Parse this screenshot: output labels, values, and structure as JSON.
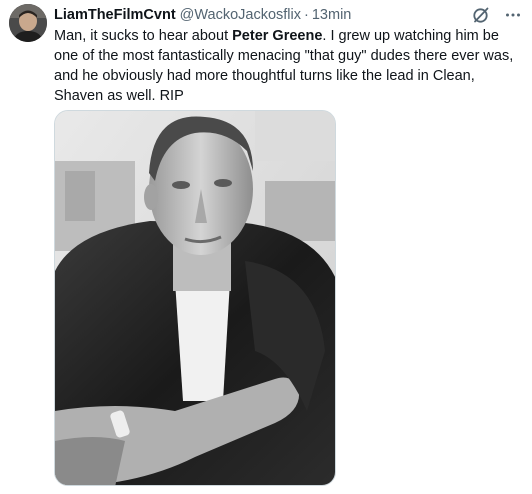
{
  "tweet": {
    "display_name": "LiamTheFilmCvnt",
    "handle": "@WackoJackosflix",
    "separator": "·",
    "time": "13min",
    "text_before": "Man, it sucks to hear about ",
    "text_bold": "Peter Greene",
    "text_after": ". I grew up watching him be one of the most fantastically menacing \"that guy\" dudes there ever was, and he obviously had more thoughtful turns like the lead in Clean, Shaven as well. RIP"
  },
  "icons": {
    "avatar": "avatar-image",
    "grok": "grok-icon",
    "more": "more-icon",
    "photo": "black-and-white-portrait-photo"
  },
  "colors": {
    "text": "#0f1419",
    "secondary": "#536471",
    "border": "#cfd9de"
  }
}
